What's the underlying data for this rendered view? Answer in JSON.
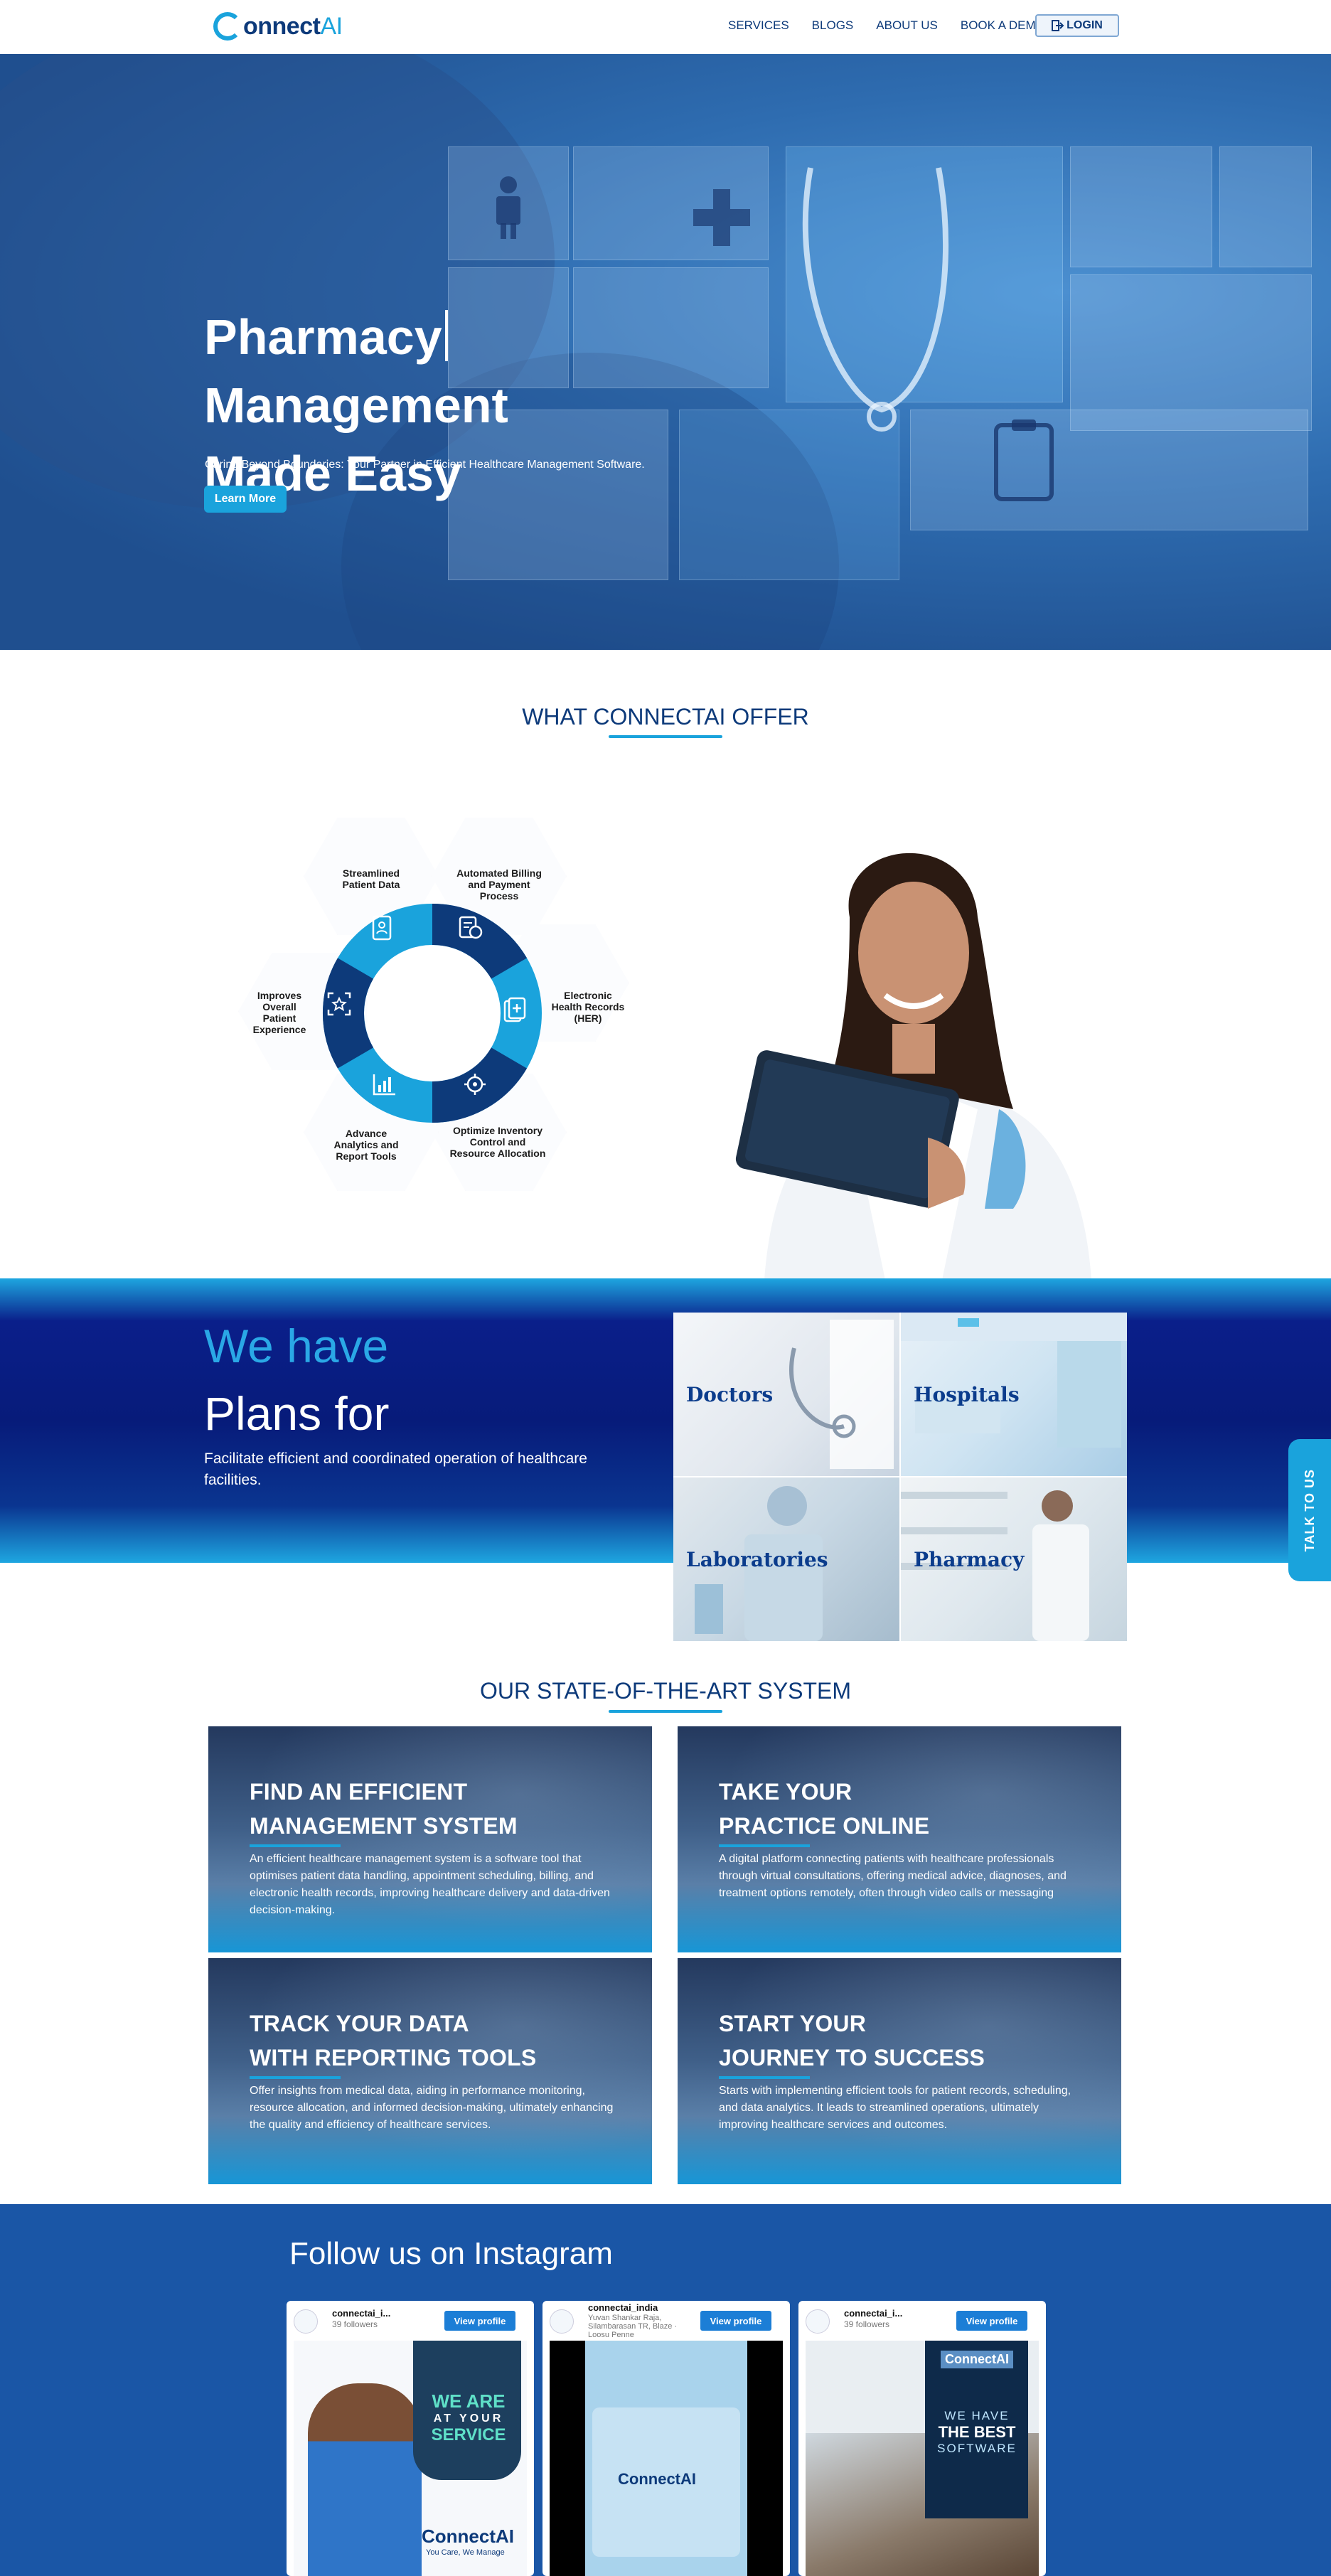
{
  "nav": {
    "logo_main": "onnect",
    "logo_ai": "AI",
    "links": [
      "SERVICES",
      "BLOGS",
      "ABOUT US",
      "BOOK A DEMO"
    ],
    "login_label": "LOGIN",
    "login_icon": "login-icon"
  },
  "hero": {
    "title_lines": [
      "Pharmacy",
      "Management",
      "Made Easy"
    ],
    "subtitle": "Caring Beyond Boundaries: Your Partner in Efficient Healthcare Management Software.",
    "cta_label": "Learn More"
  },
  "offer": {
    "title": "WHAT CONNECTAI OFFER",
    "items": [
      {
        "label": "Streamlined Patient Data",
        "icon": "patient-file-icon"
      },
      {
        "label": "Automated Billing and Payment Process",
        "icon": "billing-icon"
      },
      {
        "label": "Electronic Health Records (HER)",
        "icon": "health-record-icon"
      },
      {
        "label": "Optimize Inventory Control and Resource Allocation",
        "icon": "inventory-gear-icon"
      },
      {
        "label": "Advance Analytics and Report Tools",
        "icon": "analytics-chart-icon"
      },
      {
        "label": "Improves Overall Patient Experience",
        "icon": "patient-experience-icon"
      }
    ]
  },
  "plans": {
    "heading_1": "We have",
    "heading_2": "Plans for",
    "description": "Facilitate efficient and coordinated operation of healthcare facilities.",
    "cells": [
      "Doctors",
      "Hospitals",
      "Laboratories",
      "Pharmacy"
    ]
  },
  "talk_tab": "TALK TO US",
  "system": {
    "title": "OUR STATE-OF-THE-ART SYSTEM",
    "cards": [
      {
        "title_1": "FIND AN EFFICIENT",
        "title_2": "MANAGEMENT SYSTEM",
        "text": "An efficient healthcare management system is a software tool that optimises patient data handling, appointment scheduling, billing, and electronic health records, improving healthcare delivery and data-driven decision-making."
      },
      {
        "title_1": "TAKE YOUR",
        "title_2": "PRACTICE ONLINE",
        "text": "A digital platform connecting patients with healthcare professionals through virtual consultations, offering medical advice, diagnoses, and treatment options remotely, often through video calls or messaging"
      },
      {
        "title_1": "TRACK YOUR DATA",
        "title_2": "WITH REPORTING TOOLS",
        "text": "Offer insights from medical data, aiding in performance monitoring, resource allocation, and informed decision-making, ultimately enhancing the quality and efficiency of healthcare services."
      },
      {
        "title_1": "START YOUR",
        "title_2": "JOURNEY TO SUCCESS",
        "text": "Starts with implementing efficient tools for patient records, scheduling, and data analytics. It leads to streamlined operations, ultimately improving healthcare services and outcomes."
      }
    ]
  },
  "instagram": {
    "title": "Follow us on Instagram",
    "cards": [
      {
        "name": "connectai_i...",
        "followers": "39 followers",
        "button": "View profile",
        "post_line_1": "WE ARE",
        "post_line_2": "AT YOUR",
        "post_line_3": "SERVICE",
        "post_logo": "ConnectAI",
        "post_tag": "You Care, We Manage"
      },
      {
        "name": "connectai_india",
        "followers": "Yuvan Shankar Raja, Silambarasan TR, Blaze · Loosu Penne",
        "button": "View profile",
        "post_logo": "ConnectAI"
      },
      {
        "name": "connectai_i...",
        "followers": "39 followers",
        "button": "View profile",
        "post_logo": "ConnectAI",
        "post_line_1": "WE HAVE",
        "post_line_2": "THE BEST",
        "post_line_3": "SOFTWARE"
      }
    ]
  },
  "colors": {
    "brand_navy": "#0d3a7a",
    "brand_blue": "#1aa3dc",
    "hero_bg": "#2e6cb0",
    "plans_bg": "#071b7a",
    "insta_bg": "#1a56a6",
    "ig_button": "#1c7ed6"
  }
}
